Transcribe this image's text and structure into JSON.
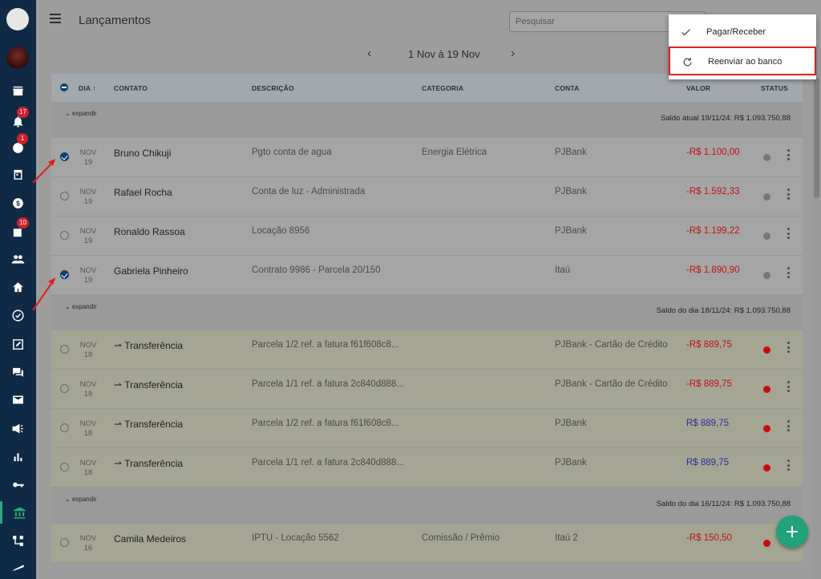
{
  "header": {
    "title": "Lançamentos",
    "search_placeholder": "Pesquisar"
  },
  "sidebar": {
    "items": [
      {
        "icon": "logo-icon"
      },
      {
        "icon": "avatar"
      },
      {
        "icon": "store-icon"
      },
      {
        "icon": "notifications-icon",
        "badge": "17"
      },
      {
        "icon": "tasks-icon",
        "badge": "1"
      },
      {
        "icon": "calendar-icon"
      },
      {
        "icon": "money-icon"
      },
      {
        "icon": "documents-icon",
        "badge": "10"
      },
      {
        "icon": "people-icon"
      },
      {
        "icon": "home-icon"
      },
      {
        "icon": "verified-icon"
      },
      {
        "icon": "edit-icon"
      },
      {
        "icon": "chat-icon"
      },
      {
        "icon": "mail-icon"
      },
      {
        "icon": "campaign-icon"
      },
      {
        "icon": "bar-chart-icon"
      },
      {
        "icon": "key-icon"
      },
      {
        "icon": "bank-icon",
        "active": true
      },
      {
        "icon": "hierarchy-icon"
      },
      {
        "icon": "truck-icon"
      }
    ]
  },
  "date_nav": {
    "range": "1 Nov à 19 Nov"
  },
  "table": {
    "columns": {
      "dia": "DIA",
      "contato": "CONTATO",
      "descricao": "DESCRIÇÃO",
      "categoria": "CATEGORIA",
      "conta": "CONTA",
      "valor": "VALOR",
      "status": "STATUS"
    },
    "groups": [
      {
        "expand": "expandir",
        "balance": "Saldo atual 19/11/24:  R$ 1.093.750,88",
        "rows": [
          {
            "month": "NOV",
            "day": "19",
            "contact": "Bruno Chikuji",
            "description": "Pgto conta de agua",
            "category": "Energia Elétrica",
            "account": "PJBank",
            "value": "-R$ 1.100,00",
            "checked": true
          },
          {
            "month": "NOV",
            "day": "19",
            "contact": "Rafael Rocha",
            "description": "Conta de luz - Administrada",
            "category": "",
            "account": "PJBank",
            "value": "-R$ 1.592,33",
            "checked": false
          },
          {
            "month": "NOV",
            "day": "19",
            "contact": "Ronaldo Rassoa",
            "description": "Locação 8956",
            "category": "",
            "account": "PJBank",
            "value": "-R$ 1.199,22",
            "checked": false
          },
          {
            "month": "NOV",
            "day": "19",
            "contact": "Gabriela Pinheiro",
            "description": "Contrato 9986 - Parcela 20/150",
            "category": "",
            "account": "Itaú",
            "value": "-R$ 1.890,90",
            "checked": true
          }
        ]
      },
      {
        "expand": "expandir",
        "balance": "Saldo do dia 18/11/24:  R$ 1.093.750,88",
        "rows": [
          {
            "month": "NOV",
            "day": "18",
            "contact": "Transferência",
            "description": "Parcela 1/2 ref. a fatura f61f608c8...",
            "category": "",
            "account": "PJBank - Cartão de Crédito",
            "value": "-R$ 889,75"
          },
          {
            "month": "NOV",
            "day": "18",
            "contact": "Transferência",
            "description": "Parcela 1/1 ref. a fatura 2c840d888...",
            "category": "",
            "account": "PJBank - Cartão de Crédito",
            "value": "-R$ 889,75"
          },
          {
            "month": "NOV",
            "day": "18",
            "contact": "Transferência",
            "description": "Parcela 1/2 ref. a fatura f61f608c8...",
            "category": "",
            "account": "PJBank",
            "value": "R$ 889,75"
          },
          {
            "month": "NOV",
            "day": "18",
            "contact": "Transferência",
            "description": "Parcela 1/1 ref. a fatura 2c840d888...",
            "category": "",
            "account": "PJBank",
            "value": "R$ 889,75"
          }
        ]
      },
      {
        "expand": "expandir",
        "balance": "Saldo do dia 16/11/24:  R$ 1.093.750,88",
        "rows": [
          {
            "month": "NOV",
            "day": "16",
            "contact": "Camila Medeiros",
            "description": "IPTU - Locação 5562",
            "category": "Comissão / Prêmio",
            "account": "Itaú 2",
            "value": "-R$ 150,50"
          }
        ]
      }
    ]
  },
  "menu": {
    "items": [
      {
        "label": "Pagar/Receber",
        "icon": "check-icon"
      },
      {
        "label": "Reenviar ao banco",
        "icon": "refresh-icon",
        "highlighted": true
      }
    ]
  },
  "colors": {
    "sidebar": "#0e2a45",
    "accent": "#21a27b",
    "negative": "#c01111",
    "positive": "#2c2ca0",
    "status_red": "#c80b0b",
    "highlight": "#e31d1d"
  }
}
